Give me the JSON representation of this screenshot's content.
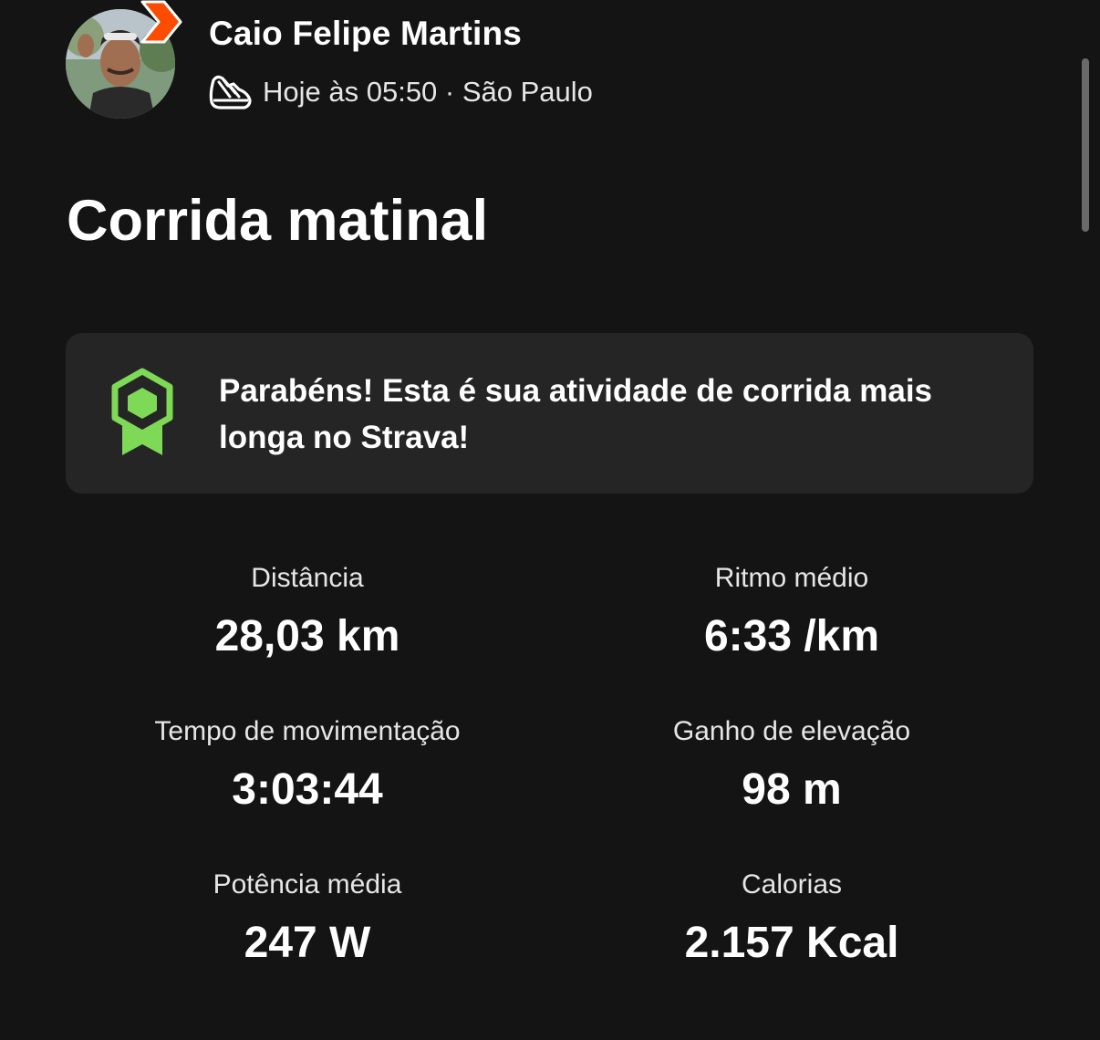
{
  "athlete": {
    "name": "Caio Felipe Martins",
    "meta": "Hoje às 05:50 · São Paulo"
  },
  "activity": {
    "title": "Corrida matinal"
  },
  "achievement": {
    "text": "Parabéns! Esta é sua atividade de corrida mais longa no Strava!"
  },
  "stats": [
    {
      "label": "Distância",
      "value": "28,03 km"
    },
    {
      "label": "Ritmo médio",
      "value": "6:33 /km"
    },
    {
      "label": "Tempo de movimentação",
      "value": "3:03:44"
    },
    {
      "label": "Ganho de elevação",
      "value": "98 m"
    },
    {
      "label": "Potência média",
      "value": "247 W"
    },
    {
      "label": "Calorias",
      "value": "2.157 Kcal"
    }
  ],
  "colors": {
    "background": "#141414",
    "card": "#252525",
    "strava_orange": "#fc4c02",
    "medal_green": "#7ed957"
  },
  "icons": {
    "activity_type": "running-shoe-icon",
    "achievement": "medal-icon",
    "subscriber_badge": "strava-chevron-badge-icon"
  }
}
